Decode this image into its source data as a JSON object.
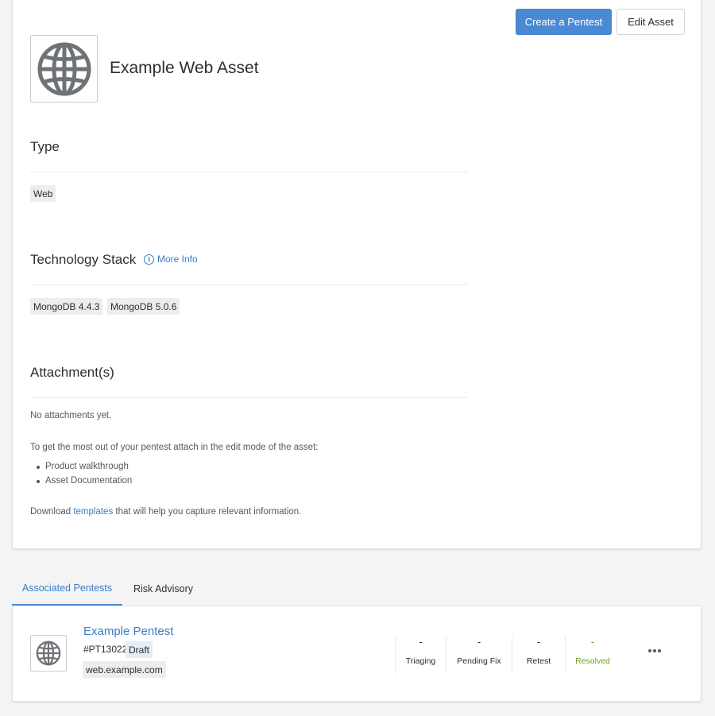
{
  "header": {
    "create_pentest": "Create a Pentest",
    "edit_asset": "Edit Asset"
  },
  "asset": {
    "title": "Example Web Asset",
    "icon": "globe-icon"
  },
  "type_section": {
    "heading": "Type",
    "tags": [
      "Web"
    ]
  },
  "tech_section": {
    "heading": "Technology Stack",
    "more_info": "More Info",
    "info_glyph": "i",
    "tags": [
      "MongoDB 4.4.3",
      "MongoDB 5.0.6"
    ]
  },
  "attachments": {
    "heading": "Attachment(s)",
    "empty": "No attachments yet.",
    "hint": "To get the most out of your pentest attach in the edit mode of the asset:",
    "items": [
      "Product walkthrough",
      "Asset Documentation"
    ],
    "download_prefix": "Download ",
    "download_link": "templates",
    "download_suffix": " that will help you capture relevant information."
  },
  "tabs": {
    "associated": "Associated Pentests",
    "risk": "Risk Advisory"
  },
  "pentest": {
    "title": "Example Pentest",
    "id": "#PT13022",
    "status": "Draft",
    "domain": "web.example.com",
    "stats": [
      {
        "value": "-",
        "label": "Triaging"
      },
      {
        "value": "-",
        "label": "Pending Fix"
      },
      {
        "value": "-",
        "label": "Retest"
      },
      {
        "value": "-",
        "label": "Resolved"
      }
    ]
  },
  "colors": {
    "primary": "#4a8ad4",
    "link": "#3a7cc7",
    "resolved": "#6aa323",
    "draft_badge": "#e5edf7"
  }
}
